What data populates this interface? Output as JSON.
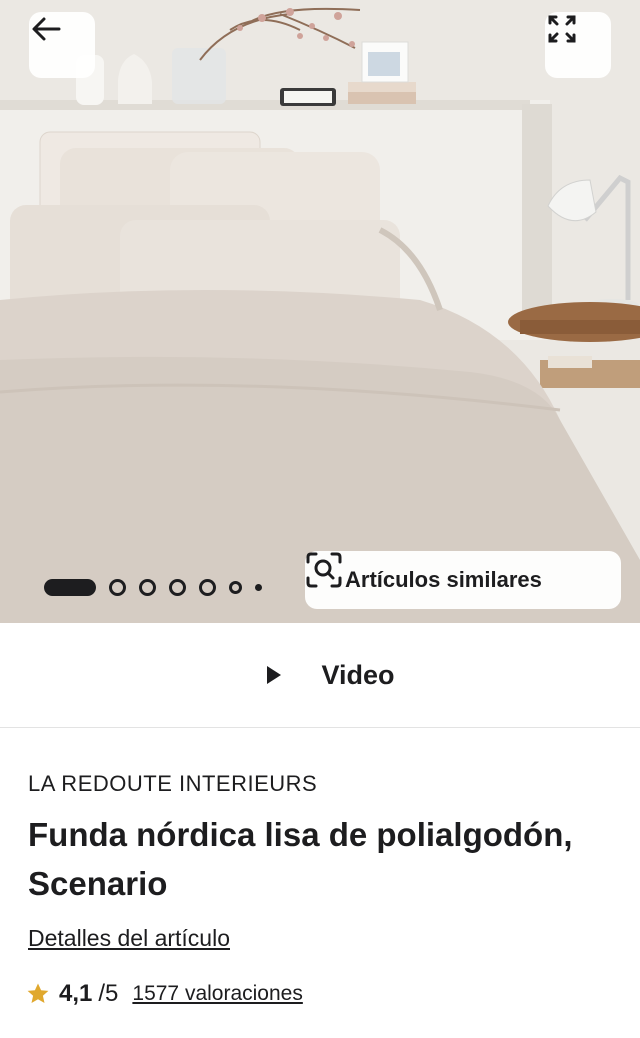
{
  "gallery": {
    "image_alt": "bedroom-photo",
    "back_icon": "arrow-left-icon",
    "expand_icon": "expand-icon",
    "slide_count": 7,
    "active_slide": 1,
    "similar_button": {
      "icon": "visual-search-icon",
      "label": "Artículos similares"
    }
  },
  "video": {
    "icon": "play-icon",
    "label": "Video"
  },
  "product": {
    "brand": "LA REDOUTE INTERIEURS",
    "title": "Funda nórdica lisa de polialgodón, Scenario",
    "details_link": "Detalles del artículo",
    "rating": {
      "icon": "star-icon",
      "value": "4,1",
      "max": "/5",
      "count_label": "1577 valoraciones",
      "star_color": "#e0a82e"
    }
  }
}
